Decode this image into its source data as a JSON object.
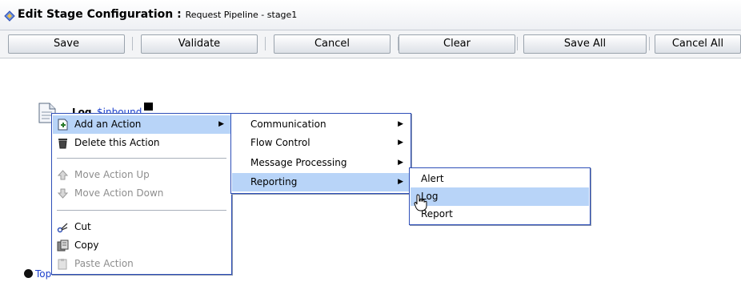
{
  "header": {
    "title": "Edit Stage Configuration",
    "separator": " : ",
    "subtitle": "Request Pipeline - stage1"
  },
  "toolbar": {
    "save": "Save",
    "validate": "Validate",
    "cancel": "Cancel",
    "clear": "Clear",
    "save_all": "Save All",
    "cancel_all": "Cancel All"
  },
  "node": {
    "label": "Log",
    "variable": "$inbound",
    "icon": "document-icon"
  },
  "footer": {
    "top_link": "Top"
  },
  "context_menu": {
    "items": [
      {
        "label": "Add an Action",
        "icon": "add-action-icon",
        "submenu": true,
        "highlighted": true,
        "disabled": false
      },
      {
        "label": "Delete this Action",
        "icon": "trash-icon",
        "submenu": false,
        "highlighted": false,
        "disabled": false
      },
      {
        "label": "Move Action Up",
        "icon": "arrow-up-icon",
        "submenu": false,
        "highlighted": false,
        "disabled": true
      },
      {
        "label": "Move Action Down",
        "icon": "arrow-down-icon",
        "submenu": false,
        "highlighted": false,
        "disabled": true
      },
      {
        "label": "Cut",
        "icon": "scissors-icon",
        "submenu": false,
        "highlighted": false,
        "disabled": false
      },
      {
        "label": "Copy",
        "icon": "copy-icon",
        "submenu": false,
        "highlighted": false,
        "disabled": false
      },
      {
        "label": "Paste Action",
        "icon": "paste-icon",
        "submenu": false,
        "highlighted": false,
        "disabled": true
      }
    ]
  },
  "action_submenu": {
    "items": [
      {
        "label": "Communication",
        "submenu": true,
        "highlighted": false
      },
      {
        "label": "Flow Control",
        "submenu": true,
        "highlighted": false
      },
      {
        "label": "Message Processing",
        "submenu": true,
        "highlighted": false
      },
      {
        "label": "Reporting",
        "submenu": true,
        "highlighted": true
      }
    ]
  },
  "reporting_submenu": {
    "items": [
      {
        "label": "Alert",
        "highlighted": false
      },
      {
        "label": "Log",
        "highlighted": true
      },
      {
        "label": "Report",
        "highlighted": false
      }
    ]
  },
  "colors": {
    "accent": "#2e4fb8",
    "highlight": "#b8d4f8",
    "link": "#1a3fcc"
  }
}
